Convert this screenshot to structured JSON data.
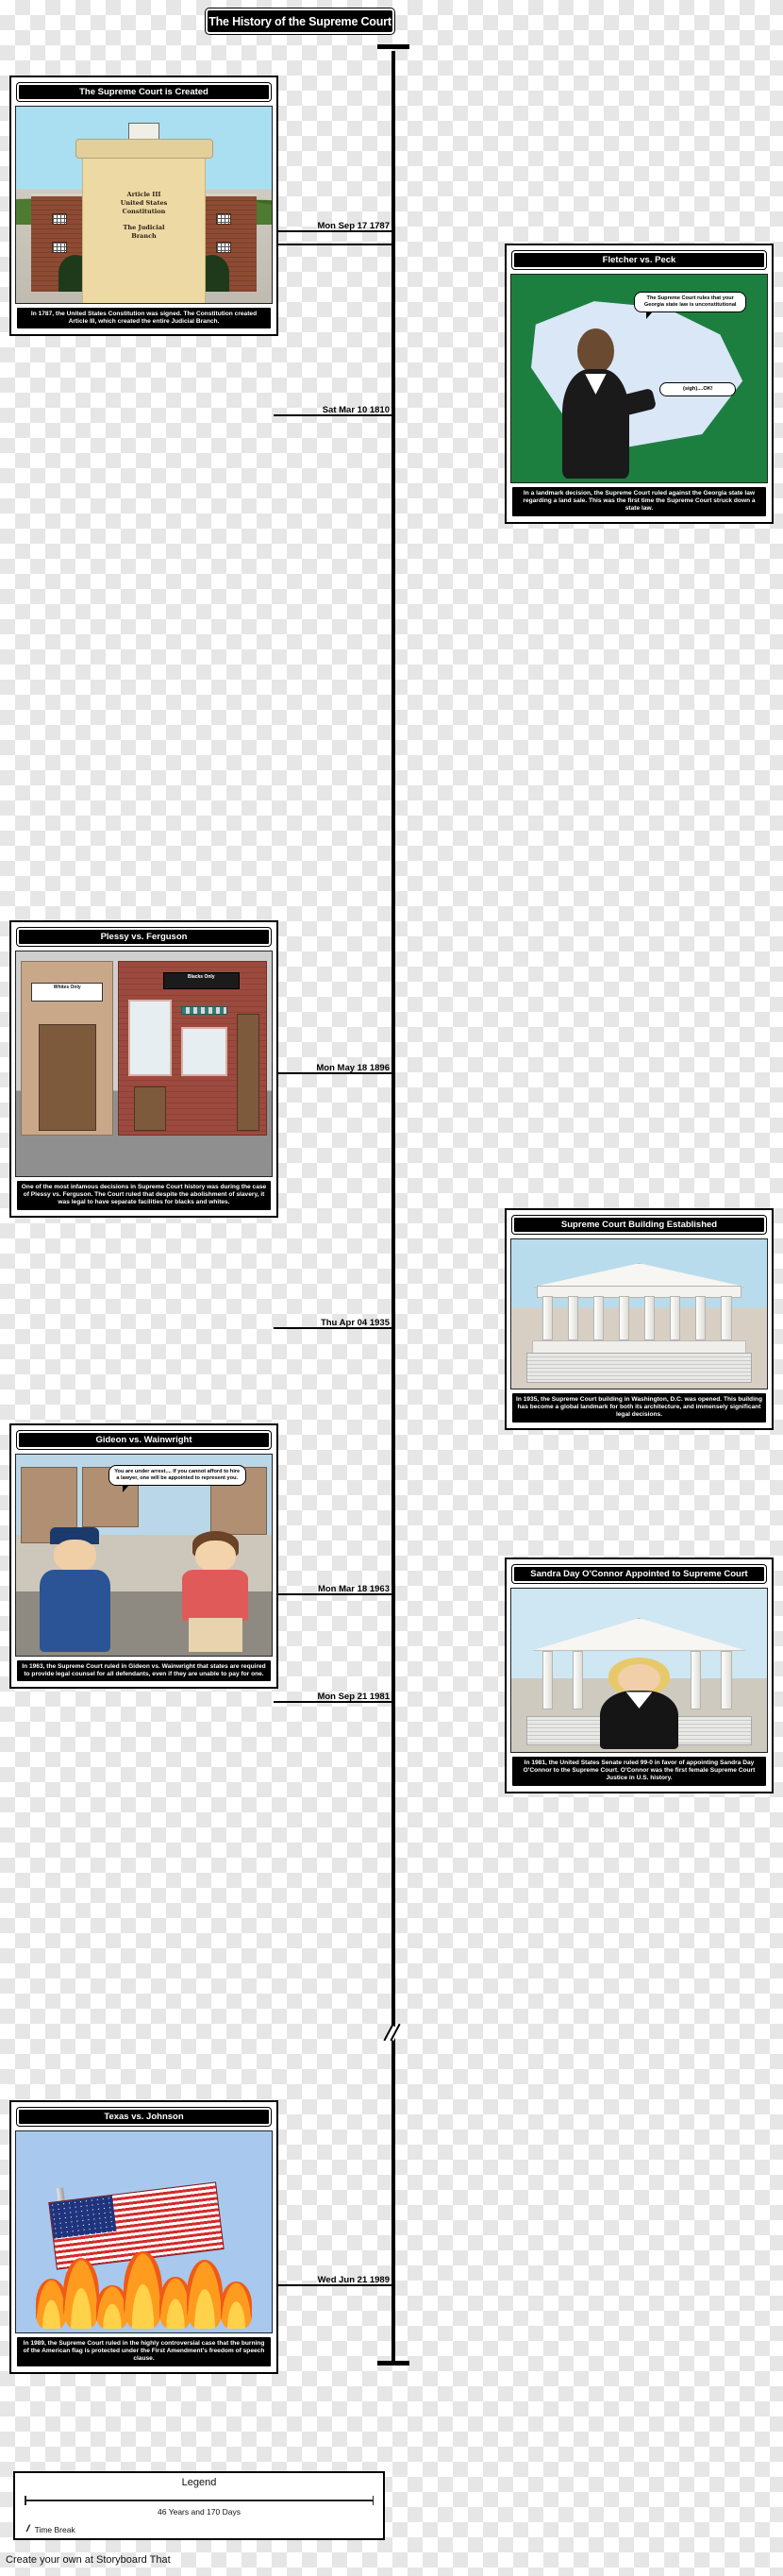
{
  "title": "The History of the Supreme Court",
  "legend": {
    "heading": "Legend",
    "duration": "46 Years and 170 Days",
    "break_label": "Time Break",
    "break_icon": "time-break-slashes"
  },
  "footer": "Create your own at Storyboard That",
  "axis": {
    "color": "#000000",
    "cap_icon": "axis-end-cap"
  },
  "dates": [
    {
      "label": "Mon Sep 17 1787"
    },
    {
      "label": "Sat Mar 10 1810"
    },
    {
      "label": "Mon May 18 1896"
    },
    {
      "label": "Thu Apr 04 1935"
    },
    {
      "label": "Mon Mar 18 1963"
    },
    {
      "label": "Mon Sep 21 1981"
    },
    {
      "label": "Wed Jun 21 1989"
    }
  ],
  "events": [
    {
      "id": "supreme-court-created",
      "side": "left",
      "title": "The Supreme Court is Created",
      "date": "Mon Sep 17 1787",
      "caption": "In 1787, the United States Constitution was signed. The Constitution created Article III, which created the entire Judicial Branch.",
      "art": {
        "kind": "courthouse-with-scroll",
        "scroll_lines_1": "Article III\nUnited States\nConstitution",
        "scroll_lines_2": "The Judicial\nBranch"
      }
    },
    {
      "id": "fletcher-vs-peck",
      "side": "right",
      "title": "Fletcher vs. Peck",
      "date": "Sat Mar 10 1810",
      "caption": "In a landmark decision, the Supreme Court ruled against the Georgia state law regarding a land sale. This was the first time the Supreme Court struck down a state law.",
      "art": {
        "kind": "judge-with-map",
        "speech_1": "The Supreme Court rules that your Georgia state law is unconstitutional",
        "speech_2": "(sigh)....OK!"
      }
    },
    {
      "id": "plessy-vs-ferguson",
      "side": "left",
      "title": "Plessy vs. Ferguson",
      "date": "Mon May 18 1896",
      "caption": "One of the most infamous decisions in Supreme Court history was during the case of Plessy vs. Ferguson. The Court ruled that despite the abolishment of slavery, it was legal to have separate facilities for blacks and whites.",
      "art": {
        "kind": "segregated-storefronts",
        "sign_1": "Whites Only",
        "sign_2": "Blacks Only"
      }
    },
    {
      "id": "supreme-court-building-established",
      "side": "right",
      "title": "Supreme Court Building Established",
      "date": "Thu Apr 04 1935",
      "caption": "In 1935, the Supreme Court building in Washington, D.C. was opened. This building has become a global landmark for both its architecture, and immensely significant legal decisions.",
      "art": {
        "kind": "neoclassical-building"
      }
    },
    {
      "id": "gideon-vs-wainwright",
      "side": "left",
      "title": "Gideon vs. Wainwright",
      "date": "Mon Mar 18 1963",
      "caption": "In 1963, the Supreme Court ruled in Gideon vs. Wainwright that states are required to provide legal counsel for all defendants, even if they are unable to pay for one.",
      "art": {
        "kind": "officer-and-citizen",
        "speech_1": "You are under arrest.... If you cannot afford to hire a lawyer, one will be appointed to represent you."
      }
    },
    {
      "id": "sandra-day-oconnor-appointed",
      "side": "right",
      "title": "Sandra Day O'Connor Appointed to Supreme Court",
      "date": "Mon Sep 21 1981",
      "caption": "In 1981, the United States Senate ruled 99-0 in favor of appointing Sandra Day O'Connor to the Supreme Court. O'Connor was the first female Supreme Court Justice in U.S. history.",
      "art": {
        "kind": "justice-portrait"
      }
    },
    {
      "id": "texas-vs-johnson",
      "side": "left",
      "title": "Texas vs. Johnson",
      "date": "Wed Jun 21 1989",
      "caption": "In 1989, the Supreme Court ruled in the highly controversial case that the burning of the American flag is protected under the First Amendment's freedom of speech clause.",
      "art": {
        "kind": "burning-american-flag"
      }
    }
  ]
}
